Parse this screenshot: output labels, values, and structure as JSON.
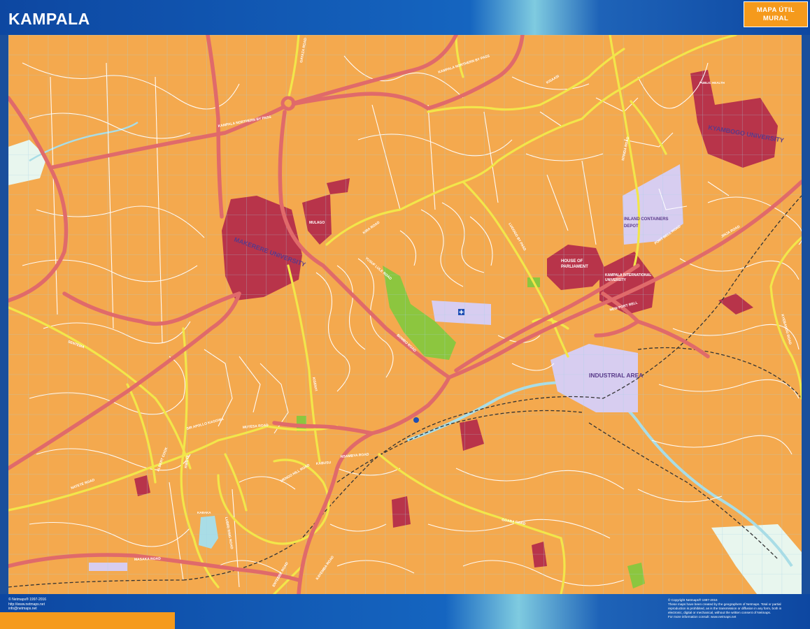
{
  "header": {
    "title": "KAMPALA",
    "badge_line1": "MAPA ÚTIL",
    "badge_line2": "MURAL"
  },
  "colors": {
    "land": "#f4a94e",
    "main_road": "#e06a6a",
    "secondary_road": "#f2e64a",
    "minor_road": "#ffffff",
    "institution": "#b8344a",
    "industrial": "#d7cdf0",
    "park": "#8cc63f",
    "water": "#a9dde6",
    "railway": "#333333",
    "header_blue": "#0d47a1",
    "badge_orange": "#f59a1c"
  },
  "map": {
    "areas": {
      "makerere": "MAKERERE UNIVERSITY",
      "kyambogo": "KYAMBOGO UNIVERSITY",
      "industrial": "INDUSTRIAL AREA",
      "inland": "INLAND CONTAINERS",
      "inland2": "DEPOT",
      "kampala_int": "KAMPALA INTERNATIONAL",
      "kampala_int2": "UNIVERSITY",
      "mulago": "MULAGO",
      "house": "HOUSE OF",
      "house2": "PARLIAMENT",
      "kabaka": "KABAKA",
      "public_health": "PUBLIC HEALTH"
    },
    "roads": {
      "northern_bypass_1": "KAMPALA NORTHERN BY PASS",
      "northern_bypass_2": "KAMPALA NORTHERN BY PASS",
      "kisaasi": "KISAASI",
      "ntinda": "NTINDA ROAD",
      "jinja": "JINJA ROAD",
      "new_port_bell": "NEW PORT BELL",
      "port_bell": "PORT BELL ROAD",
      "lugogo": "LUGOGO BY PASS",
      "yusuf_lule": "YUSUF LULE ROAD",
      "bombo": "BOMBO ROAD",
      "kira": "KIRA ROAD",
      "gayaza": "GAYAZA ROAD",
      "sentema": "SENTEMA",
      "masaka": "MASAKA ROAD",
      "natete": "NATETE ROAD",
      "ggaba": "GGABA ROAD",
      "entebbe": "ENTEBBE ROAD",
      "kabusu": "KABUSU",
      "kyebando": "KYEBANDO ROAD",
      "nsambya": "NSAMBYA ROAD",
      "mengo": "MENGO HILL ROAD",
      "lubiri": "LUBIRI RING ROAD",
      "mutesa": "MUTESA ROAD",
      "kibuye": "KIBUYE",
      "kisenyi": "KISENYI",
      "albert_cook": "ALBERT COOK",
      "sir_apollo": "SIR APOLLO KAGGWA",
      "kayemba": "KAYEMBA ROAD"
    }
  },
  "footer": {
    "left_line1": "© Netmaps® 1997-2016",
    "left_line2": "http://www.netmaps.net",
    "left_line3": "info@netmaps.net",
    "right_line1": "© Copyright Netmaps® 1997-2016",
    "right_line2": "These maps have been created by the geographers of Netmaps. Total or partial",
    "right_line3": "reproduction is prohibited, as is the transmission or diffusion in any form, both in",
    "right_line4": "electronic, digital or mechanical, without the written consent of Netmaps.",
    "right_line5": "For more information consult: www.netmaps.net"
  }
}
